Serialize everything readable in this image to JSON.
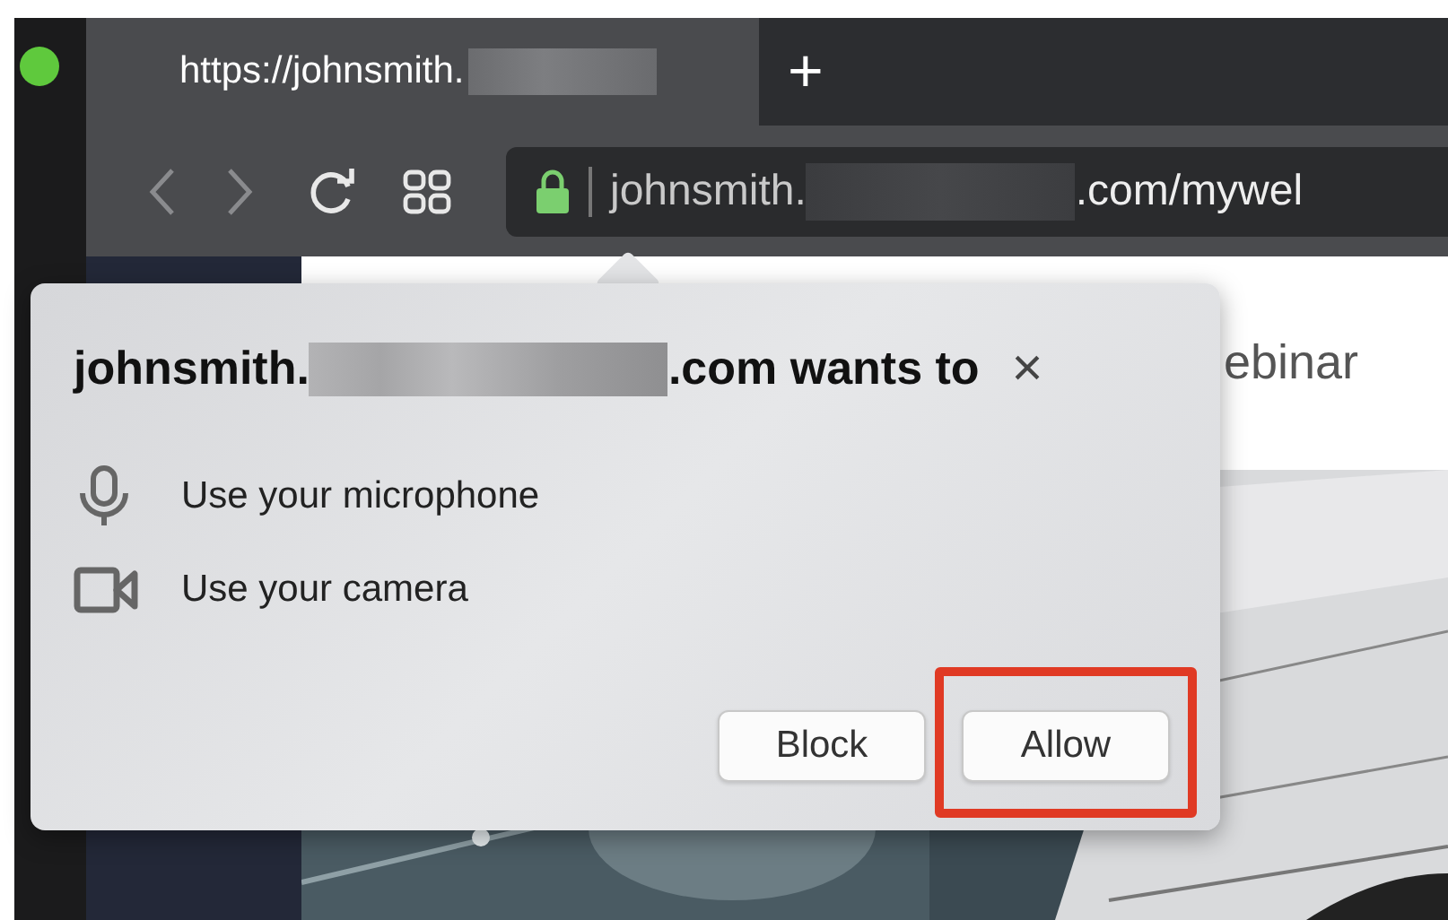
{
  "tab": {
    "title": "https://johnsmith.",
    "new_tab": "+"
  },
  "toolbar": {
    "url_host": "johnsmith.",
    "url_rest": ".com/mywel"
  },
  "page": {
    "heading": "ebinar"
  },
  "popup": {
    "title_start": "johnsmith.",
    "title_end": ".com wants to",
    "close": "×",
    "permissions": [
      {
        "kind": "microphone",
        "label": "Use your microphone"
      },
      {
        "kind": "camera",
        "label": "Use your camera"
      }
    ],
    "buttons": [
      {
        "label": "Block",
        "highlighted": false
      },
      {
        "label": "Allow",
        "highlighted": true
      }
    ]
  }
}
